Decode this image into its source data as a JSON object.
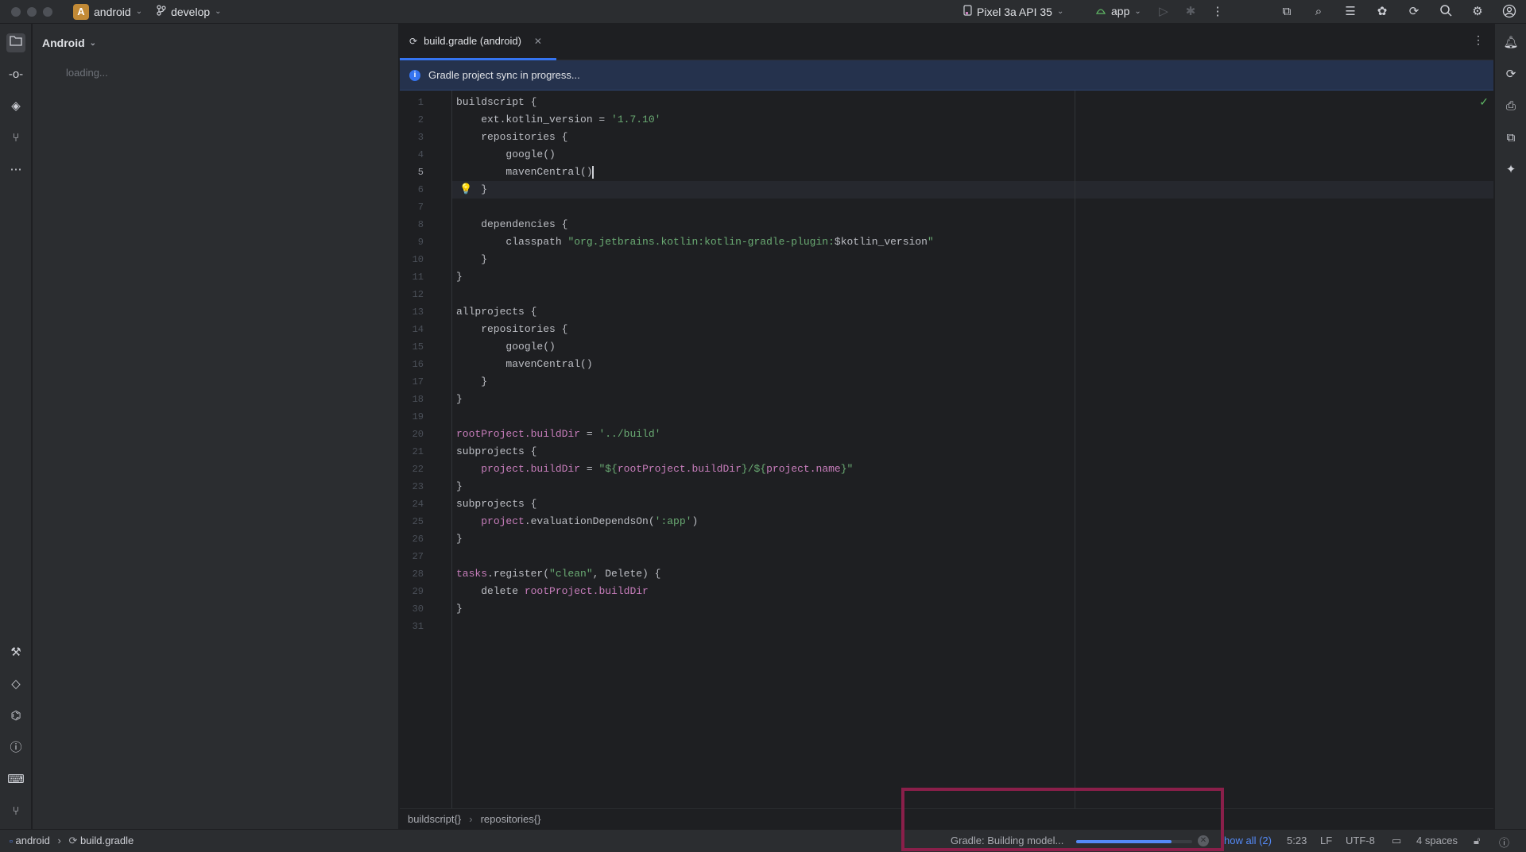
{
  "titlebar": {
    "project_initial": "A",
    "project_name": "android",
    "branch": "develop",
    "device": "Pixel 3a API 35",
    "run_config": "app"
  },
  "project_panel": {
    "view_mode": "Android",
    "status": "loading..."
  },
  "editor": {
    "tab_label": "build.gradle (android)",
    "banner_text": "Gradle project sync in progress...",
    "current_line": 5,
    "lines": [
      [
        [
          "plain",
          "buildscript {"
        ]
      ],
      [
        [
          "plain",
          "    ext.kotlin_version = "
        ],
        [
          "str",
          "'1.7.10'"
        ]
      ],
      [
        [
          "plain",
          "    repositories {"
        ]
      ],
      [
        [
          "plain",
          "        google()"
        ]
      ],
      [
        [
          "plain",
          "        mavenCentral()"
        ]
      ],
      [
        [
          "plain",
          "    }"
        ]
      ],
      [
        [
          "plain",
          ""
        ]
      ],
      [
        [
          "plain",
          "    dependencies {"
        ]
      ],
      [
        [
          "plain",
          "        classpath "
        ],
        [
          "str",
          "\"org.jetbrains.kotlin:kotlin-gradle-plugin:"
        ],
        [
          "plain",
          "$kotlin_version"
        ],
        [
          "str",
          "\""
        ]
      ],
      [
        [
          "plain",
          "    }"
        ]
      ],
      [
        [
          "plain",
          "}"
        ]
      ],
      [
        [
          "plain",
          ""
        ]
      ],
      [
        [
          "plain",
          "allprojects {"
        ]
      ],
      [
        [
          "plain",
          "    repositories {"
        ]
      ],
      [
        [
          "plain",
          "        google()"
        ]
      ],
      [
        [
          "plain",
          "        mavenCentral()"
        ]
      ],
      [
        [
          "plain",
          "    }"
        ]
      ],
      [
        [
          "plain",
          "}"
        ]
      ],
      [
        [
          "plain",
          ""
        ]
      ],
      [
        [
          "prop",
          "rootProject.buildDir"
        ],
        [
          "plain",
          " = "
        ],
        [
          "str",
          "'../build'"
        ]
      ],
      [
        [
          "plain",
          "subprojects {"
        ]
      ],
      [
        [
          "plain",
          "    "
        ],
        [
          "prop",
          "project.buildDir"
        ],
        [
          "plain",
          " = "
        ],
        [
          "str",
          "\"${"
        ],
        [
          "prop",
          "rootProject.buildDir"
        ],
        [
          "str",
          "}/${"
        ],
        [
          "prop",
          "project.name"
        ],
        [
          "str",
          "}\""
        ]
      ],
      [
        [
          "plain",
          "}"
        ]
      ],
      [
        [
          "plain",
          "subprojects {"
        ]
      ],
      [
        [
          "plain",
          "    "
        ],
        [
          "prop",
          "project"
        ],
        [
          "plain",
          ".evaluationDependsOn("
        ],
        [
          "str",
          "':app'"
        ],
        [
          "plain",
          ")"
        ]
      ],
      [
        [
          "plain",
          "}"
        ]
      ],
      [
        [
          "plain",
          ""
        ]
      ],
      [
        [
          "prop",
          "tasks"
        ],
        [
          "plain",
          ".register("
        ],
        [
          "str",
          "\"clean\""
        ],
        [
          "plain",
          ", Delete) {"
        ]
      ],
      [
        [
          "plain",
          "    delete "
        ],
        [
          "prop",
          "rootProject.buildDir"
        ]
      ],
      [
        [
          "plain",
          "}"
        ]
      ],
      [
        [
          "plain",
          ""
        ]
      ]
    ],
    "breadcrumbs": [
      "buildscript{}",
      "repositories{}"
    ]
  },
  "statusbar": {
    "path_project": "android",
    "path_file": "build.gradle",
    "task_text": "Gradle: Building model...",
    "progress": 0.82,
    "show_all": "how all (2)",
    "position": "5:23",
    "line_sep": "LF",
    "encoding": "UTF-8",
    "indent": "4 spaces"
  },
  "colors": {
    "accent": "#3574f0",
    "highlight_box": "#8a1f4a"
  }
}
